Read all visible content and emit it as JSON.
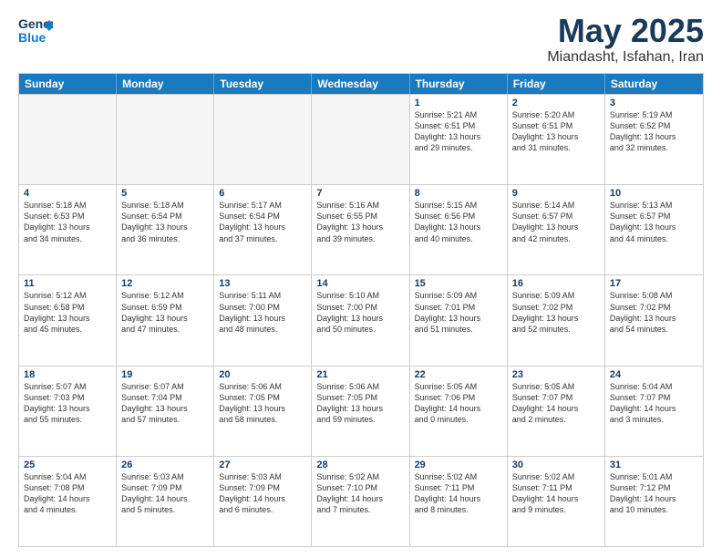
{
  "logo": {
    "line1": "General",
    "line2": "Blue"
  },
  "title": "May 2025",
  "subtitle": "Miandasht, Isfahan, Iran",
  "header_days": [
    "Sunday",
    "Monday",
    "Tuesday",
    "Wednesday",
    "Thursday",
    "Friday",
    "Saturday"
  ],
  "weeks": [
    [
      {
        "day": "",
        "text": "",
        "empty": true
      },
      {
        "day": "",
        "text": "",
        "empty": true
      },
      {
        "day": "",
        "text": "",
        "empty": true
      },
      {
        "day": "",
        "text": "",
        "empty": true
      },
      {
        "day": "1",
        "text": "Sunrise: 5:21 AM\nSunset: 6:51 PM\nDaylight: 13 hours\nand 29 minutes.",
        "empty": false
      },
      {
        "day": "2",
        "text": "Sunrise: 5:20 AM\nSunset: 6:51 PM\nDaylight: 13 hours\nand 31 minutes.",
        "empty": false
      },
      {
        "day": "3",
        "text": "Sunrise: 5:19 AM\nSunset: 6:52 PM\nDaylight: 13 hours\nand 32 minutes.",
        "empty": false
      }
    ],
    [
      {
        "day": "4",
        "text": "Sunrise: 5:18 AM\nSunset: 6:53 PM\nDaylight: 13 hours\nand 34 minutes.",
        "empty": false
      },
      {
        "day": "5",
        "text": "Sunrise: 5:18 AM\nSunset: 6:54 PM\nDaylight: 13 hours\nand 36 minutes.",
        "empty": false
      },
      {
        "day": "6",
        "text": "Sunrise: 5:17 AM\nSunset: 6:54 PM\nDaylight: 13 hours\nand 37 minutes.",
        "empty": false
      },
      {
        "day": "7",
        "text": "Sunrise: 5:16 AM\nSunset: 6:55 PM\nDaylight: 13 hours\nand 39 minutes.",
        "empty": false
      },
      {
        "day": "8",
        "text": "Sunrise: 5:15 AM\nSunset: 6:56 PM\nDaylight: 13 hours\nand 40 minutes.",
        "empty": false
      },
      {
        "day": "9",
        "text": "Sunrise: 5:14 AM\nSunset: 6:57 PM\nDaylight: 13 hours\nand 42 minutes.",
        "empty": false
      },
      {
        "day": "10",
        "text": "Sunrise: 5:13 AM\nSunset: 6:57 PM\nDaylight: 13 hours\nand 44 minutes.",
        "empty": false
      }
    ],
    [
      {
        "day": "11",
        "text": "Sunrise: 5:12 AM\nSunset: 6:58 PM\nDaylight: 13 hours\nand 45 minutes.",
        "empty": false
      },
      {
        "day": "12",
        "text": "Sunrise: 5:12 AM\nSunset: 6:59 PM\nDaylight: 13 hours\nand 47 minutes.",
        "empty": false
      },
      {
        "day": "13",
        "text": "Sunrise: 5:11 AM\nSunset: 7:00 PM\nDaylight: 13 hours\nand 48 minutes.",
        "empty": false
      },
      {
        "day": "14",
        "text": "Sunrise: 5:10 AM\nSunset: 7:00 PM\nDaylight: 13 hours\nand 50 minutes.",
        "empty": false
      },
      {
        "day": "15",
        "text": "Sunrise: 5:09 AM\nSunset: 7:01 PM\nDaylight: 13 hours\nand 51 minutes.",
        "empty": false
      },
      {
        "day": "16",
        "text": "Sunrise: 5:09 AM\nSunset: 7:02 PM\nDaylight: 13 hours\nand 52 minutes.",
        "empty": false
      },
      {
        "day": "17",
        "text": "Sunrise: 5:08 AM\nSunset: 7:02 PM\nDaylight: 13 hours\nand 54 minutes.",
        "empty": false
      }
    ],
    [
      {
        "day": "18",
        "text": "Sunrise: 5:07 AM\nSunset: 7:03 PM\nDaylight: 13 hours\nand 55 minutes.",
        "empty": false
      },
      {
        "day": "19",
        "text": "Sunrise: 5:07 AM\nSunset: 7:04 PM\nDaylight: 13 hours\nand 57 minutes.",
        "empty": false
      },
      {
        "day": "20",
        "text": "Sunrise: 5:06 AM\nSunset: 7:05 PM\nDaylight: 13 hours\nand 58 minutes.",
        "empty": false
      },
      {
        "day": "21",
        "text": "Sunrise: 5:06 AM\nSunset: 7:05 PM\nDaylight: 13 hours\nand 59 minutes.",
        "empty": false
      },
      {
        "day": "22",
        "text": "Sunrise: 5:05 AM\nSunset: 7:06 PM\nDaylight: 14 hours\nand 0 minutes.",
        "empty": false
      },
      {
        "day": "23",
        "text": "Sunrise: 5:05 AM\nSunset: 7:07 PM\nDaylight: 14 hours\nand 2 minutes.",
        "empty": false
      },
      {
        "day": "24",
        "text": "Sunrise: 5:04 AM\nSunset: 7:07 PM\nDaylight: 14 hours\nand 3 minutes.",
        "empty": false
      }
    ],
    [
      {
        "day": "25",
        "text": "Sunrise: 5:04 AM\nSunset: 7:08 PM\nDaylight: 14 hours\nand 4 minutes.",
        "empty": false
      },
      {
        "day": "26",
        "text": "Sunrise: 5:03 AM\nSunset: 7:09 PM\nDaylight: 14 hours\nand 5 minutes.",
        "empty": false
      },
      {
        "day": "27",
        "text": "Sunrise: 5:03 AM\nSunset: 7:09 PM\nDaylight: 14 hours\nand 6 minutes.",
        "empty": false
      },
      {
        "day": "28",
        "text": "Sunrise: 5:02 AM\nSunset: 7:10 PM\nDaylight: 14 hours\nand 7 minutes.",
        "empty": false
      },
      {
        "day": "29",
        "text": "Sunrise: 5:02 AM\nSunset: 7:11 PM\nDaylight: 14 hours\nand 8 minutes.",
        "empty": false
      },
      {
        "day": "30",
        "text": "Sunrise: 5:02 AM\nSunset: 7:11 PM\nDaylight: 14 hours\nand 9 minutes.",
        "empty": false
      },
      {
        "day": "31",
        "text": "Sunrise: 5:01 AM\nSunset: 7:12 PM\nDaylight: 14 hours\nand 10 minutes.",
        "empty": false
      }
    ]
  ]
}
